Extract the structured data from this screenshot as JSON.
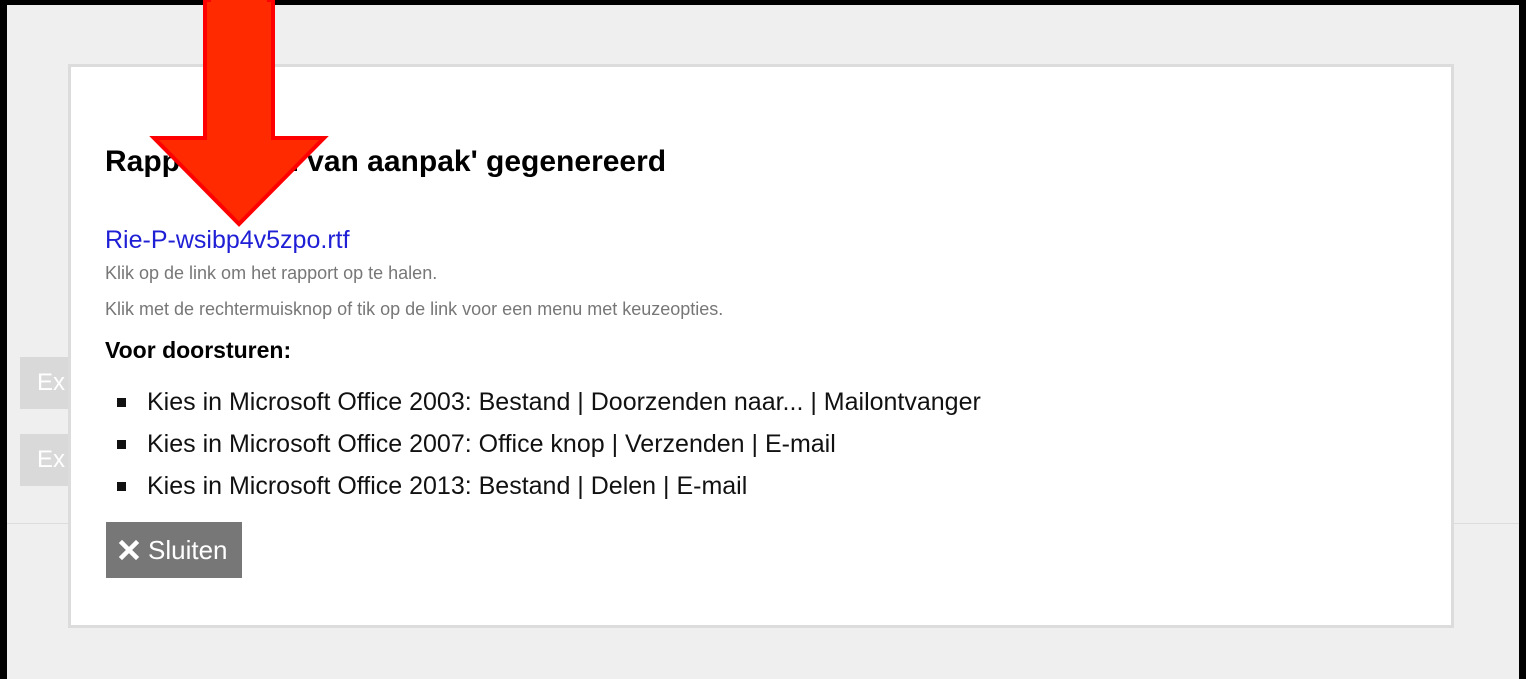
{
  "background": {
    "buttons": [
      {
        "label": "Ex"
      },
      {
        "label": "Ex"
      }
    ]
  },
  "modal": {
    "title": "Rapport 'Plan van aanpak' gegenereerd",
    "link": "Rie-P-wsibp4v5zpo.rtf",
    "hints": [
      "Klik op de link om het rapport op te halen.",
      "Klik met de rechtermuisknop of tik op de link voor een menu met keuzeopties."
    ],
    "forward_heading": "Voor doorsturen:",
    "steps": [
      "Kies in Microsoft Office 2003: Bestand | Doorzenden naar... | Mailontvanger",
      "Kies in Microsoft Office 2007: Office knop | Verzenden | E-mail",
      "Kies in Microsoft Office 2013: Bestand | Delen | E-mail"
    ],
    "close_label": "Sluiten",
    "close_icon": "close-icon"
  },
  "annotation": {
    "arrow_color": "#ff2a00",
    "arrow_outline": "#ff0000"
  },
  "colors": {
    "link": "#1f1fd6",
    "hint": "#777777",
    "close_button_bg": "#777777",
    "frame_bg": "#efefef"
  }
}
